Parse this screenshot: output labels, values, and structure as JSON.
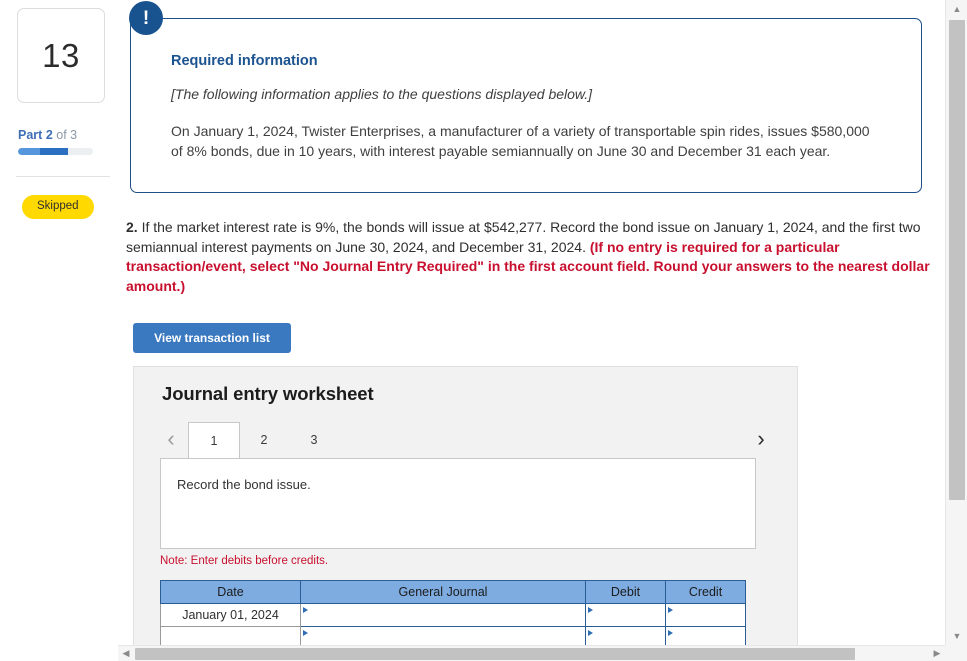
{
  "question_card": {
    "number": "13",
    "part_prefix": "Part",
    "part_current": "2",
    "part_of": "of",
    "part_total": "3",
    "status_badge": "Skipped",
    "progress_percent": 66
  },
  "callout": {
    "badge_icon": "exclamation-icon",
    "badge_glyph": "!",
    "title": "Required information",
    "italic_note": "[The following information applies to the questions displayed below.]",
    "body": "On January 1, 2024, Twister Enterprises, a manufacturer of a variety of transportable spin rides, issues $580,000 of 8% bonds, due in 10 years, with interest payable semiannually on June 30 and December 31 each year."
  },
  "question": {
    "number": "2.",
    "text_plain": " If the market interest rate is 9%, the bonds will issue at $542,277. Record the bond issue on January 1, 2024, and the first two semiannual interest payments on June 30, 2024, and December 31, 2024. ",
    "text_emphasis": "(If no entry is required for a particular transaction/event, select \"No Journal Entry Required\" in the first account field. Round your answers to the nearest dollar amount.)"
  },
  "toolbar": {
    "view_transaction_list_label": "View transaction list"
  },
  "worksheet": {
    "title": "Journal entry worksheet",
    "prev_arrow_icon": "chevron-left-icon",
    "next_arrow_icon": "chevron-right-icon",
    "prev_glyph": "‹",
    "next_glyph": "›",
    "tabs": [
      {
        "label": "1",
        "active": true
      },
      {
        "label": "2",
        "active": false
      },
      {
        "label": "3",
        "active": false
      }
    ],
    "active_tab_instruction": "Record the bond issue.",
    "note": "Note: Enter debits before credits.",
    "table": {
      "columns": [
        "Date",
        "General Journal",
        "Debit",
        "Credit"
      ],
      "rows": [
        {
          "date": "January 01, 2024",
          "general_journal": "",
          "debit": "",
          "credit": ""
        },
        {
          "date": "",
          "general_journal": "",
          "debit": "",
          "credit": ""
        }
      ]
    }
  },
  "scrollbars": {
    "vertical_up_glyph": "▲",
    "vertical_down_glyph": "▼",
    "horizontal_left_glyph": "◀",
    "horizontal_right_glyph": "▶"
  },
  "colors": {
    "accent_blue": "#3a79bf",
    "callout_border": "#1b4f86",
    "badge_navy": "#18538f",
    "table_header_blue": "#7eabe0",
    "emphasis_red": "#c8102e",
    "skipped_yellow": "#ffd900",
    "panel_grey": "#f2f2f2"
  }
}
